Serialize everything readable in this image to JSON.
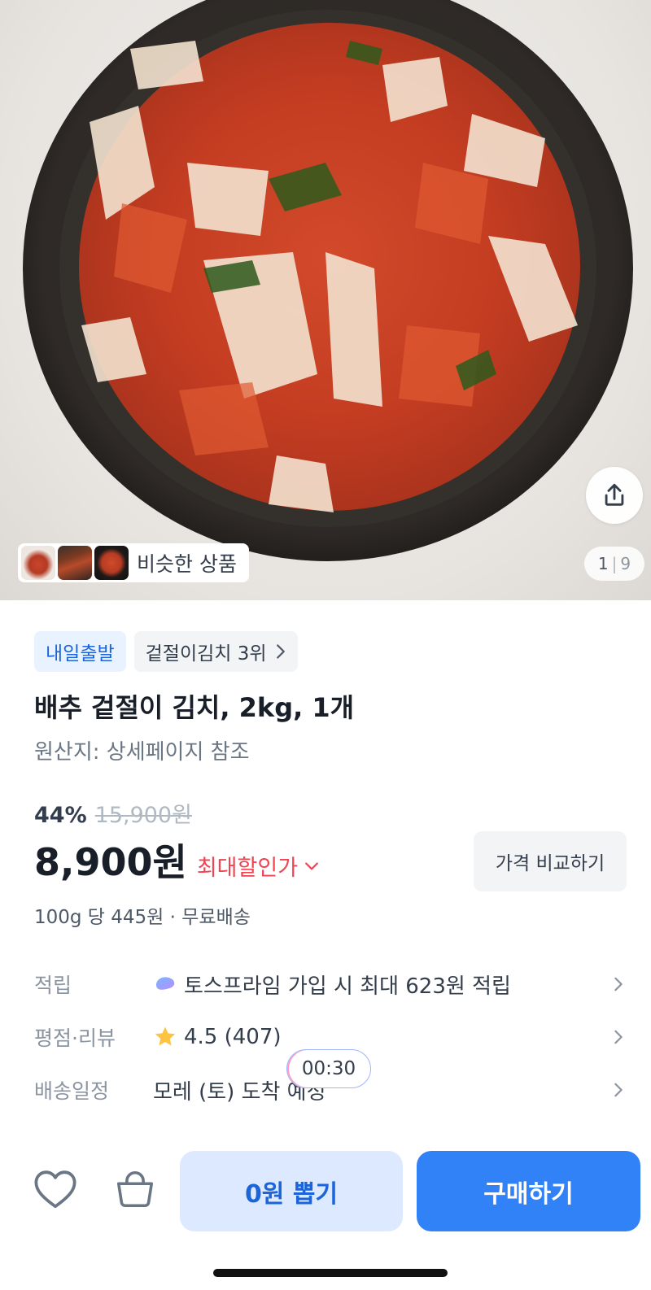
{
  "hero": {
    "image_name": "배추 겉절이 김치 product photo",
    "counter_current": "1",
    "counter_total": "9",
    "similar_label": "비슷한 상품"
  },
  "tags": [
    {
      "label": "내일출발"
    },
    {
      "label": "겉절이김치 3위"
    }
  ],
  "product": {
    "title": "배추 겉절이 김치, 2kg, 1개",
    "origin": "원산지: 상세페이지 참조",
    "discount_rate": "44%",
    "original_price": "15,900원",
    "price": "8,900원",
    "max_discount_label": "최대할인가",
    "compare_label": "가격 비교하기",
    "unit_price": "100g 당 445원 · 무료배송"
  },
  "info": {
    "points_label": "적립",
    "points_value": "토스프라임 가입 시 최대 623원 적립",
    "rating_label": "평점·리뷰",
    "rating_value": "4.5 (407)",
    "delivery_label": "배송일정",
    "delivery_value": "모레 (토) 도착 예정"
  },
  "timer": "00:30",
  "bottom": {
    "draw_label": "0원 뽑기",
    "buy_label": "구매하기"
  },
  "colors": {
    "accent": "#3182f6",
    "accent_light": "#dce9fe",
    "discount_red": "#f04452",
    "star": "#ffc342"
  },
  "icons": [
    "share-icon",
    "heart-icon",
    "cart-icon",
    "star-icon",
    "chevron-right-icon",
    "chevron-down-icon",
    "toss-prime-icon"
  ]
}
